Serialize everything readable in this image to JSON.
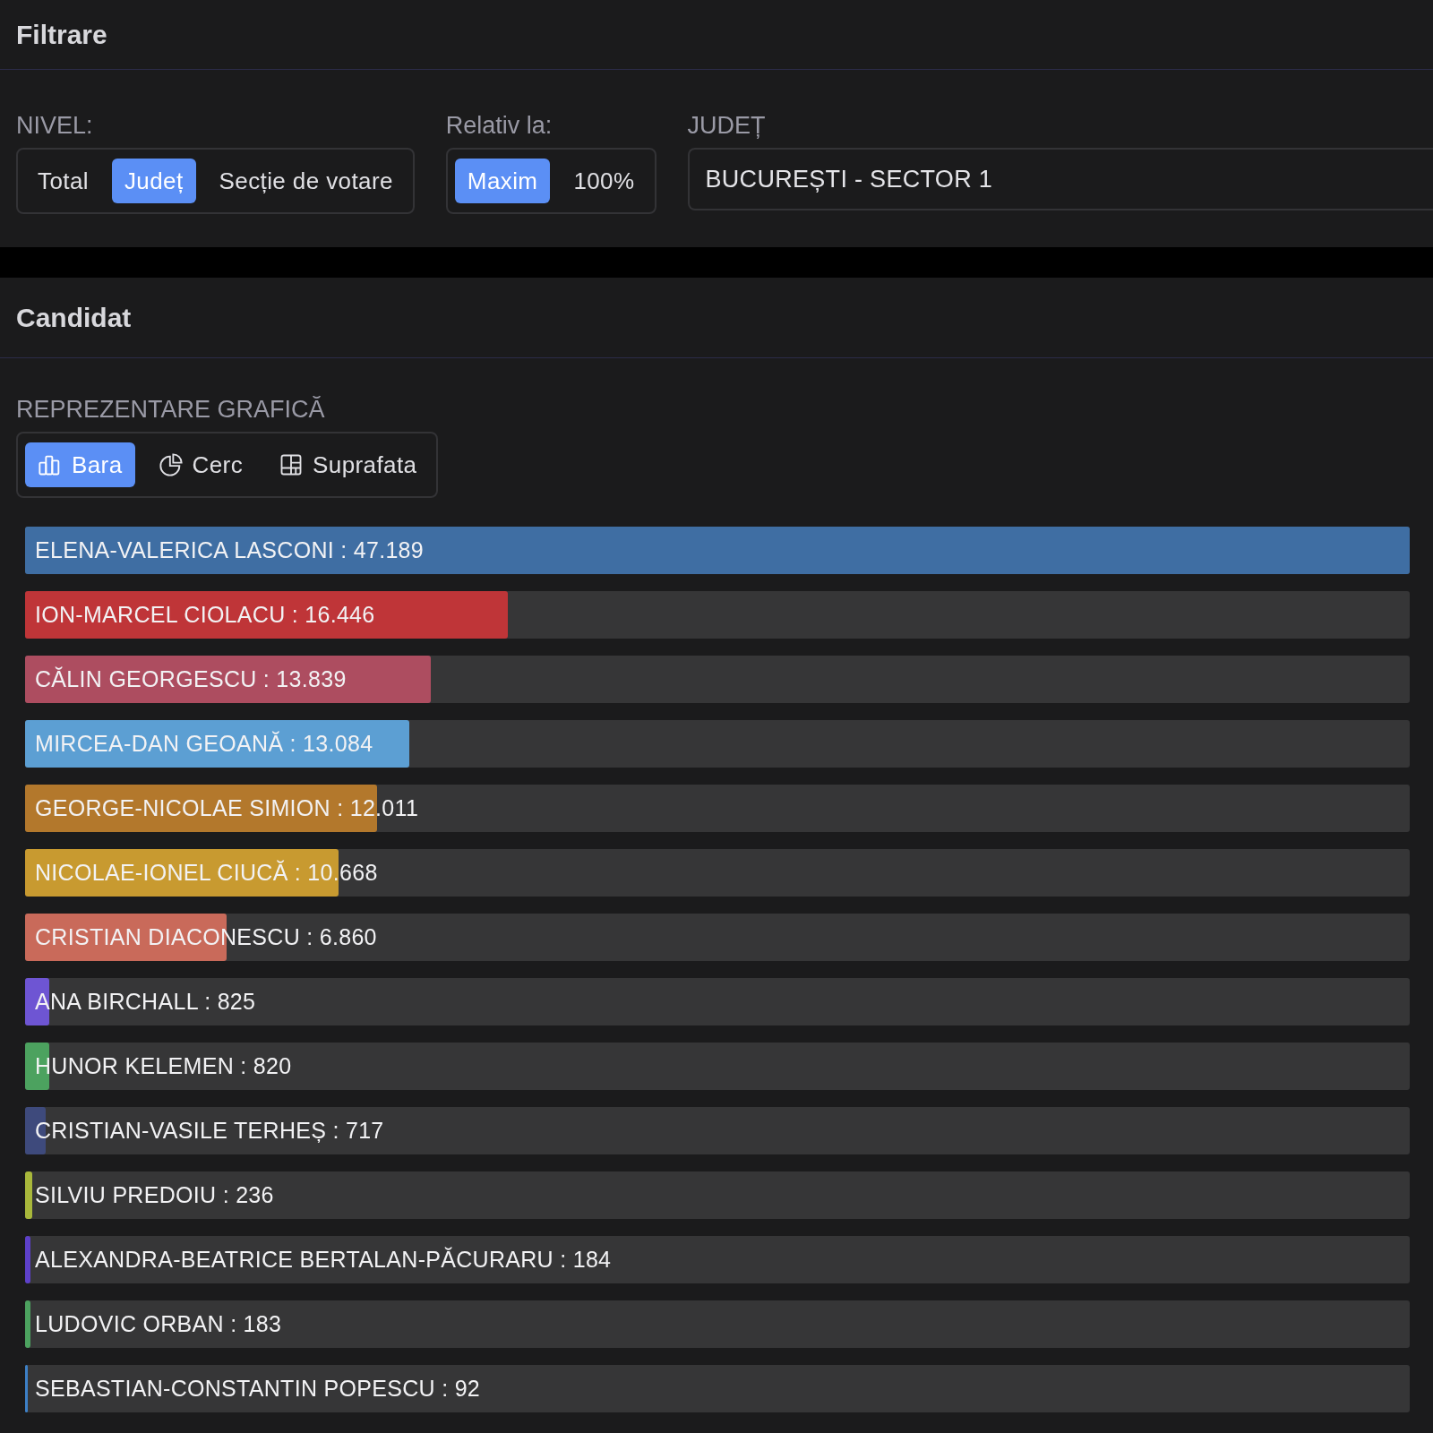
{
  "filter_panel": {
    "title": "Filtrare",
    "level_group": {
      "label": "NIVEL:",
      "options": [
        {
          "label": "Total",
          "selected": false
        },
        {
          "label": "Județ",
          "selected": true
        },
        {
          "label": "Secție de votare",
          "selected": false
        }
      ]
    },
    "relative_group": {
      "label": "Relativ la:",
      "options": [
        {
          "label": "Maxim",
          "selected": true
        },
        {
          "label": "100%",
          "selected": false
        }
      ]
    },
    "county": {
      "label": "JUDEȚ",
      "value": "BUCUREȘTI - SECTOR 1"
    }
  },
  "candidate_panel": {
    "title": "Candidat",
    "chart_type": {
      "label": "REPREZENTARE GRAFICĂ",
      "options": [
        {
          "label": "Bara",
          "kind": "bar",
          "selected": true
        },
        {
          "label": "Cerc",
          "kind": "pie",
          "selected": false
        },
        {
          "label": "Suprafata",
          "kind": "area",
          "selected": false
        }
      ]
    },
    "bars": [
      {
        "label": "ELENA-VALERICA LASCONI : 47.189",
        "level": 1,
        "color": "#3f6ea3"
      },
      {
        "label": "ION-MARCEL CIOLACU : 16.446",
        "level": 0.3485,
        "color": "#bf3538"
      },
      {
        "label": "CĂLIN GEORGESCU : 13.839",
        "level": 0.2933,
        "color": "#ad4d60"
      },
      {
        "label": "MIRCEA-DAN GEOANĂ : 13.084",
        "level": 0.2773,
        "color": "#5c9fd3"
      },
      {
        "label": "GEORGE-NICOLAE SIMION : 12.011",
        "level": 0.2545,
        "color": "#b3782c"
      },
      {
        "label": "NICOLAE-IONEL CIUCĂ : 10.668",
        "level": 0.2261,
        "color": "#c89a30"
      },
      {
        "label": "CRISTIAN DIACONESCU : 6.860",
        "level": 0.1454,
        "color": "#c96a5a"
      },
      {
        "label": "ANA BIRCHALL : 825",
        "level": 0.0175,
        "color": "#6e55d3"
      },
      {
        "label": "HUNOR KELEMEN : 820",
        "level": 0.0174,
        "color": "#4ca25f"
      },
      {
        "label": "CRISTIAN-VASILE TERHEȘ : 717",
        "level": 0.0152,
        "color": "#3e4a7c"
      },
      {
        "label": "SILVIU PREDOIU : 236",
        "level": 0.005,
        "color": "#a9b83b"
      },
      {
        "label": "ALEXANDRA-BEATRICE BERTALAN-PĂCURARU : 184",
        "level": 0.0039,
        "color": "#5d40c9"
      },
      {
        "label": "LUDOVIC ORBAN : 183",
        "level": 0.0039,
        "color": "#4ca25f"
      },
      {
        "label": "SEBASTIAN-CONSTANTIN POPESCU : 92",
        "level": 0.002,
        "color": "#3d80c6"
      }
    ]
  }
}
